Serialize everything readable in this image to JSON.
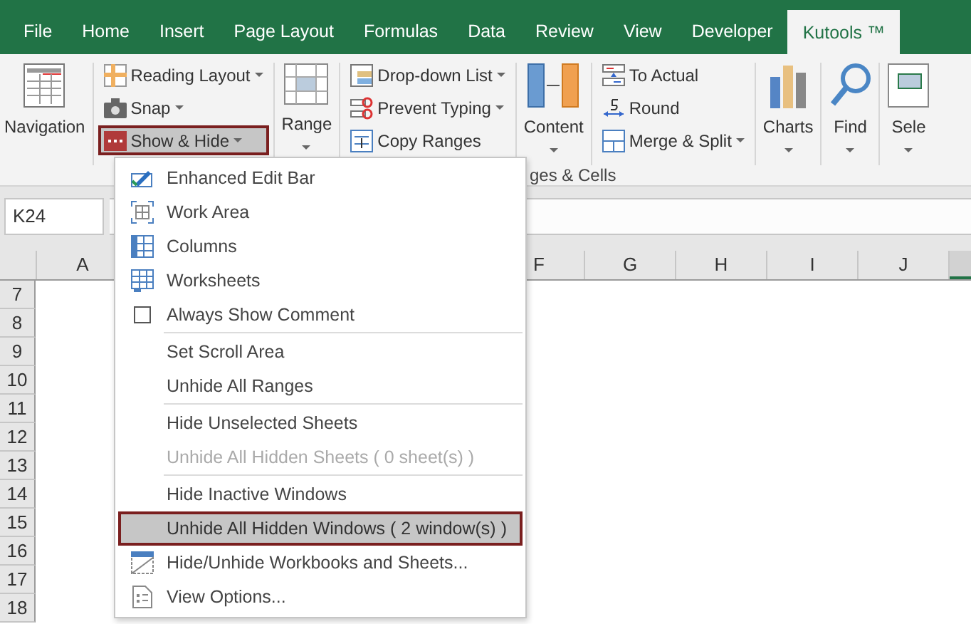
{
  "tabs": [
    {
      "label": "File",
      "selected": false
    },
    {
      "label": "Home",
      "selected": false
    },
    {
      "label": "Insert",
      "selected": false
    },
    {
      "label": "Page Layout",
      "selected": false
    },
    {
      "label": "Formulas",
      "selected": false
    },
    {
      "label": "Data",
      "selected": false
    },
    {
      "label": "Review",
      "selected": false
    },
    {
      "label": "View",
      "selected": false
    },
    {
      "label": "Developer",
      "selected": false
    },
    {
      "label": "Kutools ™",
      "selected": true
    }
  ],
  "ribbon": {
    "items": [
      {
        "kind": "large",
        "label": "Navigation",
        "dropdown": false
      },
      {
        "kind": "column",
        "buttons": [
          {
            "label": "Reading Layout",
            "dropdown": true,
            "pressed": false
          },
          {
            "label": "Snap",
            "dropdown": true,
            "pressed": false
          },
          {
            "label": "Show & Hide",
            "dropdown": true,
            "pressed": true
          }
        ]
      },
      {
        "kind": "large",
        "label": "Range",
        "dropdown": true
      },
      {
        "kind": "column",
        "buttons": [
          {
            "label": "Drop-down List",
            "dropdown": true,
            "pressed": false
          },
          {
            "label": "Prevent Typing",
            "dropdown": true,
            "pressed": false
          },
          {
            "label": "Copy Ranges",
            "dropdown": false,
            "pressed": false
          }
        ]
      },
      {
        "kind": "large",
        "label": "Content",
        "dropdown": true
      },
      {
        "kind": "column",
        "buttons": [
          {
            "label": "To Actual",
            "dropdown": false,
            "pressed": false
          },
          {
            "label": "Round",
            "dropdown": false,
            "pressed": false
          },
          {
            "label": "Merge & Split",
            "dropdown": true,
            "pressed": false
          }
        ]
      },
      {
        "kind": "large",
        "label": "Charts",
        "dropdown": true
      },
      {
        "kind": "large",
        "label": "Find",
        "dropdown": true
      },
      {
        "kind": "large",
        "label": "Sele",
        "dropdown": true
      }
    ],
    "group_label": "ges & Cells"
  },
  "name_box": "K24",
  "columns": [
    {
      "label": "A",
      "selected": false
    },
    {
      "label": "F",
      "selected": false
    },
    {
      "label": "G",
      "selected": false
    },
    {
      "label": "H",
      "selected": false
    },
    {
      "label": "I",
      "selected": false
    },
    {
      "label": "J",
      "selected": false
    },
    {
      "selected": true
    }
  ],
  "rows": [
    "7",
    "8",
    "9",
    "10",
    "11",
    "12",
    "13",
    "14",
    "15",
    "16",
    "17",
    "18"
  ],
  "menu": [
    {
      "kind": "item",
      "label": "Enhanced Edit Bar",
      "disabled": false,
      "selected": false
    },
    {
      "kind": "item",
      "label": "Work Area",
      "disabled": false,
      "selected": false
    },
    {
      "kind": "item",
      "label": "Columns",
      "disabled": false,
      "selected": false
    },
    {
      "kind": "item",
      "label": "Worksheets",
      "disabled": false,
      "selected": false
    },
    {
      "kind": "check",
      "label": "Always Show Comment",
      "checked": false,
      "disabled": false,
      "selected": false
    },
    {
      "kind": "separator"
    },
    {
      "kind": "item",
      "label": "Set Scroll Area",
      "disabled": false,
      "selected": false
    },
    {
      "kind": "item",
      "label": "Unhide All Ranges",
      "disabled": false,
      "selected": false
    },
    {
      "kind": "separator"
    },
    {
      "kind": "item",
      "label": "Hide Unselected Sheets",
      "disabled": false,
      "selected": false
    },
    {
      "kind": "item",
      "label": "Unhide All Hidden Sheets ( 0 sheet(s) )",
      "disabled": true,
      "selected": false
    },
    {
      "kind": "separator"
    },
    {
      "kind": "item",
      "label": "Hide Inactive Windows",
      "disabled": false,
      "selected": false
    },
    {
      "kind": "item",
      "label": "Unhide All Hidden Windows ( 2 window(s) )",
      "disabled": false,
      "selected": true
    },
    {
      "kind": "item",
      "label": "Hide/Unhide Workbooks and Sheets...",
      "disabled": false,
      "selected": false
    },
    {
      "kind": "item",
      "label": "View Options...",
      "disabled": false,
      "selected": false
    }
  ]
}
